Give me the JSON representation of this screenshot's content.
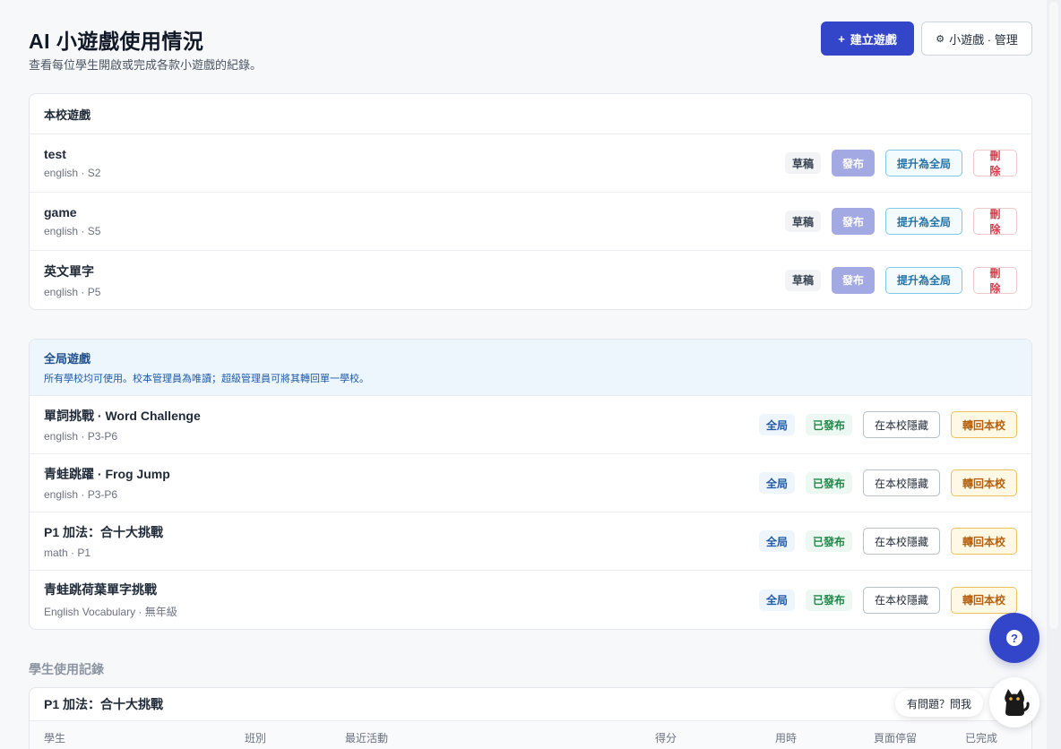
{
  "header": {
    "title": "AI 小遊戲使用情況",
    "subtitle": "查看每位學生開啟或完成各款小遊戲的紀錄。",
    "create_button": "建立遊戲",
    "create_icon": "+",
    "manage_button": "小遊戲 · 管理",
    "manage_icon": "gear-icon"
  },
  "school_games": {
    "title": "本校遊戲",
    "rows": [
      {
        "name": "test",
        "meta": "english · S2",
        "status": "草稿",
        "publish": "發布",
        "promote": "提升為全局",
        "delete": "刪除"
      },
      {
        "name": "game",
        "meta": "english · S5",
        "status": "草稿",
        "publish": "發布",
        "promote": "提升為全局",
        "delete": "刪除"
      },
      {
        "name": "英文單字",
        "meta": "english · P5",
        "status": "草稿",
        "publish": "發布",
        "promote": "提升為全局",
        "delete": "刪除"
      }
    ]
  },
  "global_games": {
    "title": "全局遊戲",
    "description": "所有學校均可使用。校本管理員為唯讀；超級管理員可將其轉回單一學校。",
    "rows": [
      {
        "name": "單詞挑戰 · Word Challenge",
        "meta": "english · P3-P6",
        "scope": "全局",
        "status": "已發布",
        "hide": "在本校隱藏",
        "return": "轉回本校"
      },
      {
        "name": "青蛙跳躍 · Frog Jump",
        "meta": "english · P3-P6",
        "scope": "全局",
        "status": "已發布",
        "hide": "在本校隱藏",
        "return": "轉回本校"
      },
      {
        "name": "P1 加法：合十大挑戰",
        "meta": "math · P1",
        "scope": "全局",
        "status": "已發布",
        "hide": "在本校隱藏",
        "return": "轉回本校"
      },
      {
        "name": "青蛙跳荷葉單字挑戰",
        "meta": "English Vocabulary · 無年級",
        "scope": "全局",
        "status": "已發布",
        "hide": "在本校隱藏",
        "return": "轉回本校"
      }
    ]
  },
  "usage_log": {
    "section_label": "學生使用記錄",
    "table_title": "P1 加法：合十大挑戰",
    "columns": {
      "student": "學生",
      "class": "班別",
      "recent": "最近活動",
      "score": "得分",
      "time": "用時",
      "dwell": "頁面停留",
      "completed": "已完成"
    }
  },
  "help": {
    "fab_icon": "?",
    "ask_label": "有問題？問我"
  }
}
